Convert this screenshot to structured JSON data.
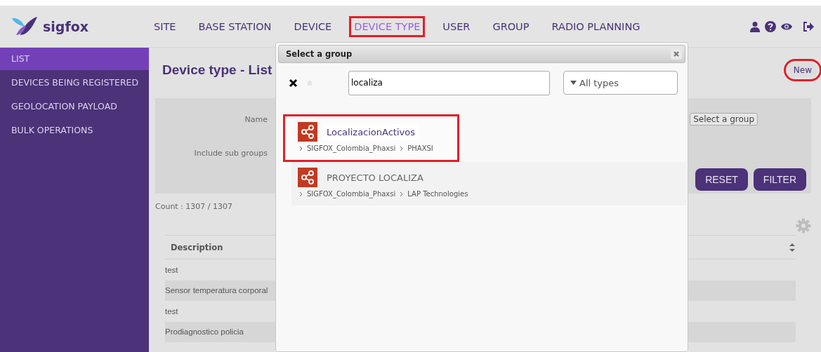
{
  "brand": "sigfox",
  "nav": [
    {
      "label": "SITE",
      "selected": false,
      "highlighted": false
    },
    {
      "label": "BASE STATION",
      "selected": false,
      "highlighted": false
    },
    {
      "label": "DEVICE",
      "selected": false,
      "highlighted": false
    },
    {
      "label": "DEVICE TYPE",
      "selected": true,
      "highlighted": true
    },
    {
      "label": "USER",
      "selected": false,
      "highlighted": false
    },
    {
      "label": "GROUP",
      "selected": false,
      "highlighted": false
    },
    {
      "label": "RADIO PLANNING",
      "selected": false,
      "highlighted": false
    }
  ],
  "sidebar": {
    "items": [
      {
        "label": "LIST",
        "selected": true
      },
      {
        "label": "DEVICES BEING REGISTERED",
        "selected": false
      },
      {
        "label": "GEOLOCATION PAYLOAD",
        "selected": false
      },
      {
        "label": "BULK OPERATIONS",
        "selected": false
      }
    ]
  },
  "page_title": "Device type - List",
  "new_button": {
    "label": "New",
    "highlighted": true
  },
  "filter": {
    "name_label": "Name",
    "subgroups_label": "Include sub groups",
    "group_button": "Select a group",
    "buttons": [
      "RESET",
      "FILTER"
    ]
  },
  "count": "Count : 1307 / 1307",
  "table": {
    "columns": [
      "Description"
    ],
    "rows": [
      {
        "description": "test"
      },
      {
        "description": "Sensor temperatura corporal"
      },
      {
        "description": "test"
      },
      {
        "description": "Prodiagnostico policia"
      }
    ]
  },
  "dialog": {
    "title": "Select a group",
    "search": {
      "value": "localiza"
    },
    "type_select": "All types",
    "results": [
      {
        "name": "LocalizacionActivos",
        "path": [
          "SIGFOX_Colombia_Phaxsi",
          "PHAXSI"
        ],
        "highlighted": true,
        "selected": true
      },
      {
        "name": "PROYECTO LOCALIZA",
        "path": [
          "SIGFOX_Colombia_Phaxsi",
          "LAP Technologies"
        ],
        "highlighted": false,
        "selected": false
      }
    ]
  }
}
